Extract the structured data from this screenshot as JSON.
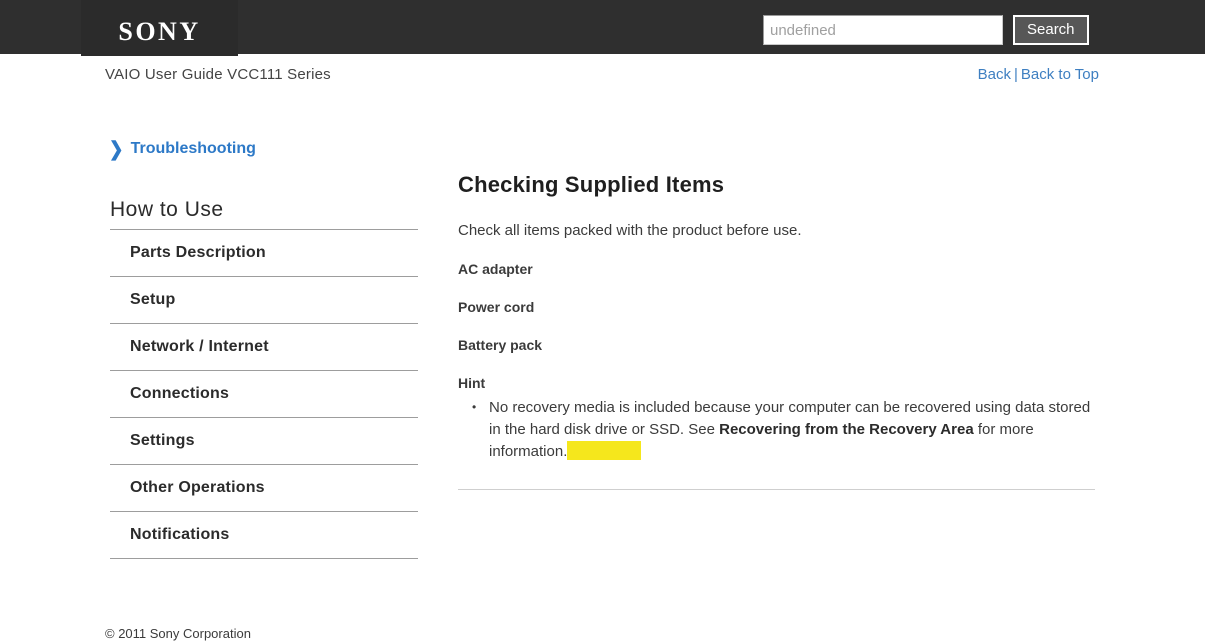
{
  "header": {
    "logo_text": "SONY",
    "search": {
      "value": "",
      "placeholder": "undefined",
      "button_label": "Search"
    }
  },
  "subheader": {
    "guide_title": "VAIO User Guide VCC111 Series",
    "back_label": "Back",
    "separator": "|",
    "back_to_top_label": "Back to Top"
  },
  "sidebar": {
    "troubleshooting_label": "Troubleshooting",
    "chevron_glyph": "❯",
    "section_title": "How to Use",
    "items": [
      {
        "label": "Parts Description"
      },
      {
        "label": "Setup"
      },
      {
        "label": "Network / Internet"
      },
      {
        "label": "Connections"
      },
      {
        "label": "Settings"
      },
      {
        "label": "Other Operations"
      },
      {
        "label": "Notifications"
      }
    ]
  },
  "main": {
    "title": "Checking Supplied Items",
    "intro": "Check all items packed with the product before use.",
    "supplied_items": [
      {
        "label": "AC adapter"
      },
      {
        "label": "Power cord"
      },
      {
        "label": "Battery pack"
      }
    ],
    "hint_label": "Hint",
    "hint": {
      "part1": "No recovery media is included because your computer can be recovered using data stored in the hard disk drive or SSD. See ",
      "bold_ref": "Recovering from the Recovery Area",
      "part2": " for more information.",
      "highlight_color": "#f5e71c"
    }
  },
  "footer": {
    "copyright": "© 2011 Sony Corporation"
  },
  "colors": {
    "header_bg": "#2f2f2f",
    "logo_bg": "#2b2b2b",
    "link_blue": "#3e7fc1",
    "troubleshooting_blue": "#2d79c7",
    "highlight_yellow": "#f5e71c"
  }
}
